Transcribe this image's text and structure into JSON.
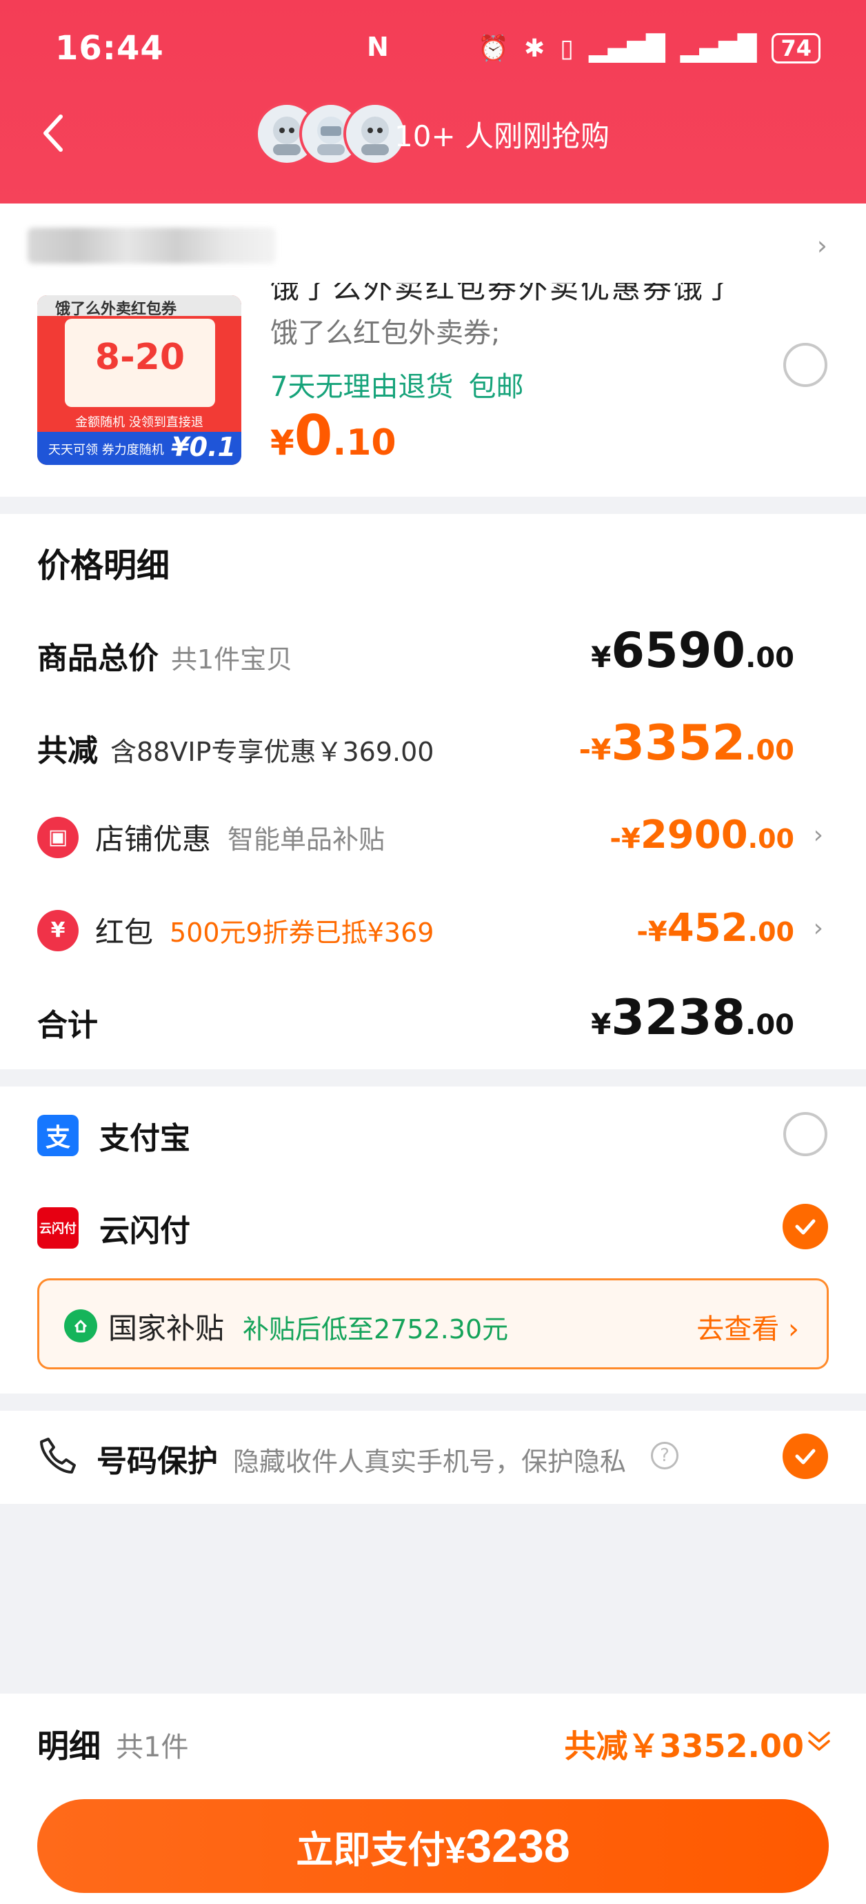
{
  "status_bar": {
    "time": "16:44",
    "battery": "74"
  },
  "header": {
    "buyers_text": "10+ 人刚刚抢购"
  },
  "product": {
    "image": {
      "top_title": "饿了么外卖红包券",
      "big_text": "8-20",
      "sub_text": "金额随机 没领到直接退",
      "footer_text": "天天可领 券力度随机",
      "price_tag": "¥0.1"
    },
    "title": "饿了么外卖红包券外卖优惠券饿了么",
    "spec": "饿了么红包外卖券;",
    "tags": [
      "7天无理由退货",
      "包邮"
    ],
    "price": {
      "currency": "¥",
      "integer": "0",
      "decimal": ".10"
    }
  },
  "price_detail": {
    "title": "价格明细",
    "goods_total": {
      "label": "商品总价",
      "sub": "共1件宝贝",
      "currency": "¥",
      "integer": "6590",
      "decimal": ".00"
    },
    "total_reduction": {
      "label": "共减",
      "sub": "含88VIP专享优惠￥369.00",
      "currency": "-¥",
      "integer": "3352",
      "decimal": ".00"
    },
    "shop_discount": {
      "label": "店铺优惠",
      "sub": "智能单品补贴",
      "currency": "-¥",
      "integer": "2900",
      "decimal": ".00"
    },
    "red_packet": {
      "label": "红包",
      "sub": "500元9折券已抵¥369",
      "currency": "-¥",
      "integer": "452",
      "decimal": ".00"
    },
    "sum": {
      "label": "合计",
      "currency": "¥",
      "integer": "3238",
      "decimal": ".00"
    }
  },
  "payment": {
    "alipay": {
      "label": "支付宝",
      "icon_char": "支",
      "selected": false
    },
    "unionpay": {
      "label": "云闪付",
      "icon_char": "云闪付",
      "selected": true
    },
    "subsidy": {
      "label": "国家补贴",
      "detail": "补贴后低至2752.30元",
      "link": "去查看 ›"
    }
  },
  "number_protection": {
    "label": "号码保护",
    "desc": "隐藏收件人真实手机号，保护隐私",
    "help": "?",
    "enabled": true
  },
  "bottom": {
    "detail_label": "明细",
    "detail_count": "共1件",
    "total_reduction": "共减￥3352.00",
    "pay_button_text": "立即支付¥",
    "pay_button_amount": "3238"
  },
  "colors": {
    "header": "#f5435a",
    "accent_orange": "#ff6a00",
    "green": "#16a37a",
    "alipay_blue": "#1677ff"
  },
  "icons": [
    "back-icon",
    "nfc-icon",
    "alarm-icon",
    "bluetooth-icon",
    "vibrate-icon",
    "signal-icon",
    "battery-icon",
    "shop-icon",
    "red-packet-icon",
    "alipay-icon",
    "unionpay-icon",
    "phone-icon",
    "help-icon",
    "chevron-down-icon",
    "check-icon"
  ]
}
